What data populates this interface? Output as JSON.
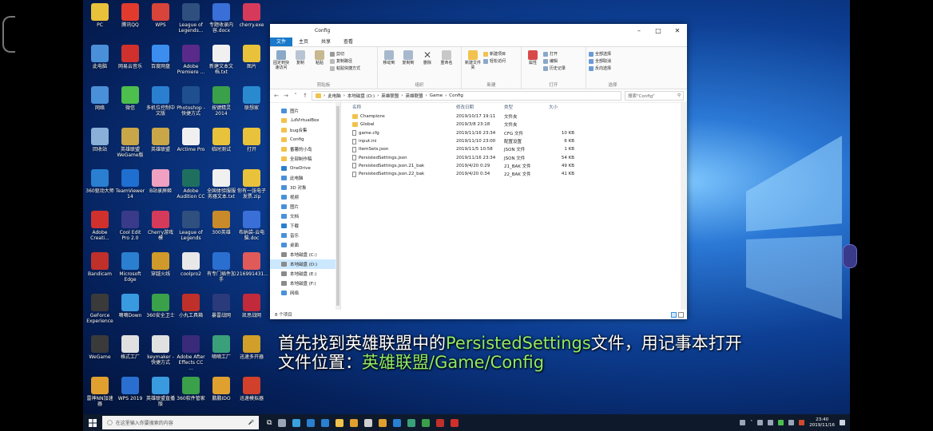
{
  "desktop_icons": [
    {
      "label": "PC",
      "color": "#e8c23a",
      "col": 0,
      "row": 0
    },
    {
      "label": "腾讯QQ",
      "color": "#e23b2e",
      "col": 1,
      "row": 0
    },
    {
      "label": "WPS",
      "color": "#d9443a",
      "col": 2,
      "row": 0
    },
    {
      "label": "League of Legends...",
      "color": "#2f4f7f",
      "col": 3,
      "row": 0
    },
    {
      "label": "专题收录内容.docx",
      "color": "#3a6fd8",
      "col": 4,
      "row": 0
    },
    {
      "label": "cherry.exe",
      "color": "#d63a5a",
      "col": 5,
      "row": 0
    },
    {
      "label": "此电脑",
      "color": "#4a90d9",
      "col": 0,
      "row": 1
    },
    {
      "label": "网易云音乐",
      "color": "#d0312d",
      "col": 1,
      "row": 1
    },
    {
      "label": "百度网盘",
      "color": "#3b8ef0",
      "col": 2,
      "row": 1
    },
    {
      "label": "Adobe Premiere ...",
      "color": "#5a2a8a",
      "col": 3,
      "row": 1
    },
    {
      "label": "新建文本文档.txt",
      "color": "#f0f0f0",
      "col": 4,
      "row": 1
    },
    {
      "label": "图片",
      "color": "#e8c23a",
      "col": 5,
      "row": 1
    },
    {
      "label": "网络",
      "color": "#4a90d9",
      "col": 0,
      "row": 2
    },
    {
      "label": "微信",
      "color": "#4cbf4c",
      "col": 1,
      "row": 2
    },
    {
      "label": "多机位控制中文版",
      "color": "#2a7fd0",
      "col": 2,
      "row": 2
    },
    {
      "label": "Photoshop - 快捷方式",
      "color": "#1f4f8f",
      "col": 3,
      "row": 2
    },
    {
      "label": "按键精灵2014",
      "color": "#3aa04a",
      "col": 4,
      "row": 2
    },
    {
      "label": "联想家",
      "color": "#2a8ad0",
      "col": 5,
      "row": 2
    },
    {
      "label": "回收站",
      "color": "#8ab0d8",
      "col": 0,
      "row": 3
    },
    {
      "label": "英雄联盟WeGame版",
      "color": "#c9a648",
      "col": 1,
      "row": 3
    },
    {
      "label": "英雄联盟",
      "color": "#c9a648",
      "col": 2,
      "row": 3
    },
    {
      "label": "Arctime Pro",
      "color": "#f0f0f0",
      "col": 3,
      "row": 3
    },
    {
      "label": "临时测试",
      "color": "#e8c23a",
      "col": 4,
      "row": 3
    },
    {
      "label": "打开",
      "color": "#e8c23a",
      "col": 5,
      "row": 3
    },
    {
      "label": "360驱动大师",
      "color": "#2a7fd0",
      "col": 0,
      "row": 4
    },
    {
      "label": "TeamViewer 14",
      "color": "#1e6fd0",
      "col": 1,
      "row": 4
    },
    {
      "label": "B站录屏姬",
      "color": "#f0a0c0",
      "col": 2,
      "row": 4
    },
    {
      "label": "Adobe Audition CC",
      "color": "#1f6f5f",
      "col": 3,
      "row": 4
    },
    {
      "label": "全国体验服服务器文本.txt",
      "color": "#f0f0f0",
      "col": 4,
      "row": 4
    },
    {
      "label": "你有一张电子发票.zip",
      "color": "#e8c23a",
      "col": 5,
      "row": 4
    },
    {
      "label": "Adobe Creati...",
      "color": "#d0312d",
      "col": 0,
      "row": 5
    },
    {
      "label": "Cool Edit Pro 2.0",
      "color": "#3a3a8a",
      "col": 1,
      "row": 5
    },
    {
      "label": "Cherry游戏模",
      "color": "#d63a5a",
      "col": 2,
      "row": 5
    },
    {
      "label": "League of Legends",
      "color": "#2f4f7f",
      "col": 3,
      "row": 5
    },
    {
      "label": "300英雄",
      "color": "#c98a2a",
      "col": 4,
      "row": 5
    },
    {
      "label": "布纳袋-云电脑.doc",
      "color": "#3a6fd8",
      "col": 5,
      "row": 5
    },
    {
      "label": "Bandicam",
      "color": "#c0302a",
      "col": 0,
      "row": 6
    },
    {
      "label": "Microsoft Edge",
      "color": "#2a7fd0",
      "col": 1,
      "row": 6
    },
    {
      "label": "穿越火线",
      "color": "#d09a2a",
      "col": 2,
      "row": 6
    },
    {
      "label": "coolpro2",
      "color": "#e8e8e8",
      "col": 3,
      "row": 6
    },
    {
      "label": "有专门插件加手",
      "color": "#2a6fd0",
      "col": 4,
      "row": 6
    },
    {
      "label": "216991431...",
      "color": "#e05a5a",
      "col": 5,
      "row": 6
    },
    {
      "label": "GeForce Experience",
      "color": "#3a3a3a",
      "col": 0,
      "row": 7
    },
    {
      "label": "嘀嘀Down",
      "color": "#3a9ae0",
      "col": 1,
      "row": 7
    },
    {
      "label": "360安全卫士",
      "color": "#3aa04a",
      "col": 2,
      "row": 7
    },
    {
      "label": "小丸工具箱",
      "color": "#c0302a",
      "col": 3,
      "row": 7
    },
    {
      "label": "暴雷战网",
      "color": "#2a3a7a",
      "col": 4,
      "row": 7
    },
    {
      "label": "凯思战网",
      "color": "#c02a3a",
      "col": 5,
      "row": 7
    },
    {
      "label": "WeGame",
      "color": "#3a3a3a",
      "col": 0,
      "row": 8
    },
    {
      "label": "格式工厂",
      "color": "#e0e0e0",
      "col": 1,
      "row": 8
    },
    {
      "label": "keymaker - 快捷方式",
      "color": "#e0e0e0",
      "col": 2,
      "row": 8
    },
    {
      "label": "Adobe After Effects CC ...",
      "color": "#3a2a7a",
      "col": 3,
      "row": 8
    },
    {
      "label": "嘀嘀工厂",
      "color": "#3aa07a",
      "col": 4,
      "row": 8
    },
    {
      "label": "迅速多开器",
      "color": "#d0a02a",
      "col": 5,
      "row": 8
    },
    {
      "label": "雷神NN加速器",
      "color": "#e0a030",
      "col": 0,
      "row": 9
    },
    {
      "label": "WPS 2019",
      "color": "#2a6fd0",
      "col": 1,
      "row": 9
    },
    {
      "label": "英雄联盟直播版",
      "color": "#3a9ae0",
      "col": 2,
      "row": 9
    },
    {
      "label": "360软件管家",
      "color": "#3aa04a",
      "col": 3,
      "row": 9
    },
    {
      "label": "鹏鹏IDO",
      "color": "#e0a030",
      "col": 4,
      "row": 9
    },
    {
      "label": "迅速模拟器",
      "color": "#d0402a",
      "col": 5,
      "row": 9
    }
  ],
  "explorer": {
    "title": "Config",
    "tabs": [
      "文件",
      "主页",
      "共享",
      "查看"
    ],
    "ribbon": {
      "clipboard": {
        "name": "剪贴板",
        "pin": "固定到快速访问",
        "copy": "复制",
        "paste": "粘贴",
        "cut": "剪切",
        "copy_path": "复制路径",
        "paste_shortcut": "粘贴快捷方式"
      },
      "organize": {
        "name": "组织",
        "move_to": "移动到",
        "copy_to": "复制到",
        "delete": "删除",
        "rename": "重命名"
      },
      "new": {
        "name": "新建",
        "new_folder": "新建文件夹",
        "new_item": "新建项目",
        "easy_access": "轻松访问"
      },
      "open": {
        "name": "打开",
        "properties": "属性",
        "open": "打开",
        "edit": "编辑",
        "history": "历史记录"
      },
      "select": {
        "name": "选择",
        "select_all": "全部选择",
        "select_none": "全部取消",
        "invert": "反向选择"
      }
    },
    "address": {
      "segments": [
        "此电脑",
        "本地磁盘 (D:)",
        "英雄联盟",
        "英雄联盟",
        "Game",
        "Config"
      ],
      "search_placeholder": "搜索\"Config\""
    },
    "nav_items": [
      {
        "label": "图片",
        "color": "#4a90d9",
        "sel": false
      },
      {
        "label": ".LdVirtualBox",
        "color": "#f1c24c",
        "sel": false
      },
      {
        "label": "bug合集",
        "color": "#f1c24c",
        "sel": false
      },
      {
        "label": "Config",
        "color": "#f1c24c",
        "sel": false
      },
      {
        "label": "番薯的小岛",
        "color": "#f1c24c",
        "sel": false
      },
      {
        "label": "全部制作稿",
        "color": "#f1c24c",
        "sel": false
      },
      {
        "label": "OneDrive",
        "color": "#2a7fd0",
        "sel": false
      },
      {
        "label": "此电脑",
        "color": "#4a90d9",
        "sel": false
      },
      {
        "label": "3D 对象",
        "color": "#4a90d9",
        "sel": false
      },
      {
        "label": "视频",
        "color": "#4a90d9",
        "sel": false
      },
      {
        "label": "图片",
        "color": "#4a90d9",
        "sel": false
      },
      {
        "label": "文档",
        "color": "#4a90d9",
        "sel": false
      },
      {
        "label": "下载",
        "color": "#2a7fd0",
        "sel": false
      },
      {
        "label": "音乐",
        "color": "#4a90d9",
        "sel": false
      },
      {
        "label": "桌面",
        "color": "#4a90d9",
        "sel": false
      },
      {
        "label": "本地磁盘 (C:)",
        "color": "#8a8a8a",
        "sel": false
      },
      {
        "label": "本地磁盘 (D:)",
        "color": "#8a8a8a",
        "sel": true
      },
      {
        "label": "本地磁盘 (E:)",
        "color": "#8a8a8a",
        "sel": false
      },
      {
        "label": "本地磁盘 (F:)",
        "color": "#8a8a8a",
        "sel": false
      },
      {
        "label": "网络",
        "color": "#4a90d9",
        "sel": false
      }
    ],
    "columns": {
      "name": "名称",
      "date": "修改日期",
      "type": "类型",
      "size": "大小"
    },
    "files": [
      {
        "name": "Champions",
        "date": "2019/10/17 19:11",
        "type": "文件夹",
        "size": "",
        "kind": "folder"
      },
      {
        "name": "Global",
        "date": "2019/3/8 23:18",
        "type": "文件夹",
        "size": "",
        "kind": "folder"
      },
      {
        "name": "game.cfg",
        "date": "2019/11/16 23:34",
        "type": "CFG 文件",
        "size": "10 KB",
        "kind": "file"
      },
      {
        "name": "input.ini",
        "date": "2019/11/10 23:00",
        "type": "配置设置",
        "size": "6 KB",
        "kind": "file"
      },
      {
        "name": "ItemSets.json",
        "date": "2019/11/5 10:58",
        "type": "JSON 文件",
        "size": "1 KB",
        "kind": "file"
      },
      {
        "name": "PersistedSettings.json",
        "date": "2019/11/16 23:34",
        "type": "JSON 文件",
        "size": "54 KB",
        "kind": "file"
      },
      {
        "name": "PersistedSettings.json.21_bak",
        "date": "2019/4/20 0:29",
        "type": "21_BAK 文件",
        "size": "49 KB",
        "kind": "file"
      },
      {
        "name": "PersistedSettings.json.22_bak",
        "date": "2019/4/20 0:34",
        "type": "22_BAK 文件",
        "size": "41 KB",
        "kind": "file"
      }
    ],
    "status": "8 个项目"
  },
  "subtitle": {
    "line1_prefix": "首先找到英雄联盟中的",
    "line1_hl": "PersistedSettings",
    "line1_suffix": "文件，用记事本打开",
    "line2_prefix": "文件位置：",
    "line2_hl": "英雄联盟/Game/Config"
  },
  "taskbar": {
    "search_placeholder": "在这里输入你要搜索的内容",
    "time": "23:40",
    "date": "2019/11/16",
    "apps": [
      "#9aa6b8",
      "#3aa0e0",
      "#2a7fd0",
      "#2a7fd0",
      "#f1c24c",
      "#e0a030",
      "#d0d0d0",
      "#e0a030",
      "#2a7fd0",
      "#3aa07a",
      "#3aa04a",
      "#c0302a",
      "#d0302a"
    ]
  }
}
